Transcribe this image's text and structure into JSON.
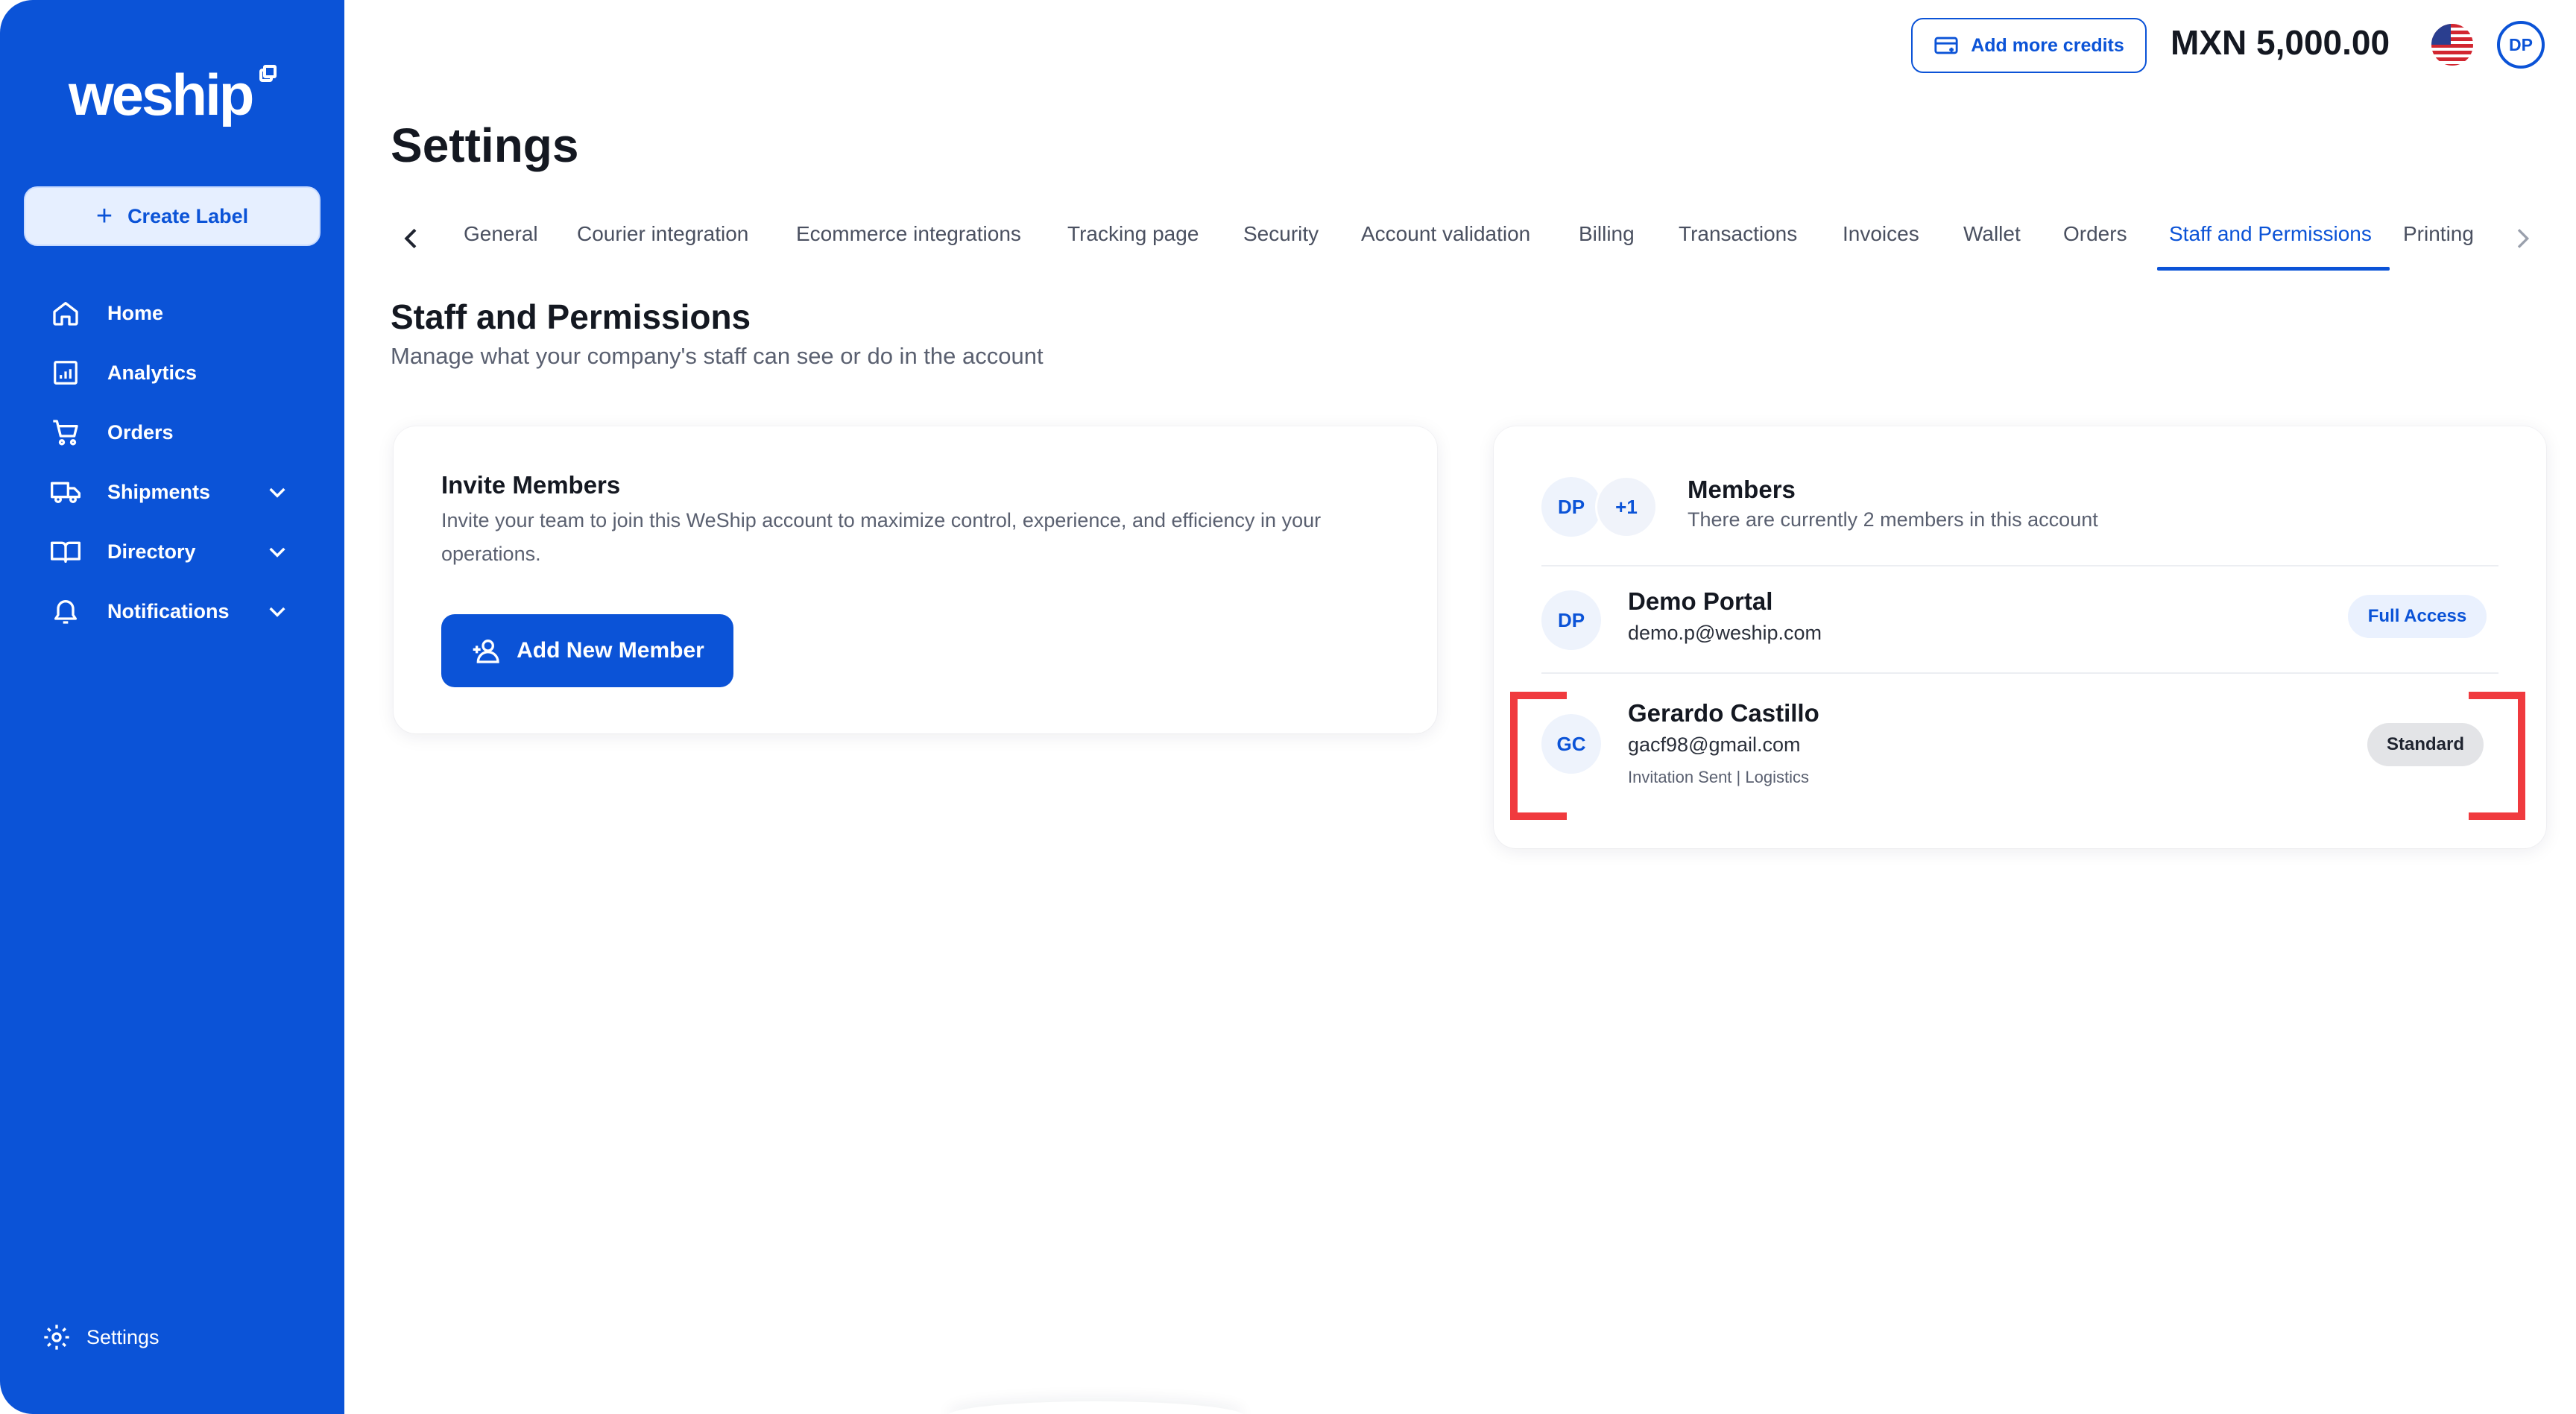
{
  "brand": {
    "logo": "weship",
    "accent": "#0b53d7",
    "highlight": "#f03a3e"
  },
  "sidebar": {
    "create_label": "Create Label",
    "items": [
      {
        "label": "Home",
        "icon": "home-icon"
      },
      {
        "label": "Analytics",
        "icon": "analytics-icon"
      },
      {
        "label": "Orders",
        "icon": "cart-icon"
      },
      {
        "label": "Shipments",
        "icon": "truck-icon",
        "expandable": true
      },
      {
        "label": "Directory",
        "icon": "book-icon",
        "expandable": true
      },
      {
        "label": "Notifications",
        "icon": "bell-icon",
        "expandable": true
      }
    ],
    "settings_label": "Settings"
  },
  "header": {
    "credits_button": "Add more credits",
    "balance": "MXN 5,000.00",
    "flag": "us-flag-icon",
    "user_initials": "DP"
  },
  "page": {
    "title": "Settings",
    "tabs": [
      "General",
      "Courier integration",
      "Ecommerce integrations",
      "Tracking page",
      "Security",
      "Account validation",
      "Billing",
      "Transactions",
      "Invoices",
      "Wallet",
      "Orders",
      "Staff and Permissions",
      "Printing"
    ],
    "active_tab": "Staff and Permissions",
    "section_title": "Staff and Permissions",
    "section_subtitle": "Manage what your company's staff can see or do in the account"
  },
  "invite": {
    "title": "Invite Members",
    "description": "Invite your team to join this WeShip account to maximize control, experience, and efficiency in your operations.",
    "button": "Add New Member"
  },
  "members": {
    "title": "Members",
    "subtitle": "There are currently 2 members in this account",
    "avatar_initials": "DP",
    "extra_count": "+1",
    "list": [
      {
        "initials": "DP",
        "name": "Demo Portal",
        "email": "demo.p@weship.com",
        "meta": "",
        "role": "Full Access"
      },
      {
        "initials": "GC",
        "name": "Gerardo Castillo",
        "email": "gacf98@gmail.com",
        "meta": "Invitation Sent | Logistics",
        "role": "Standard"
      }
    ]
  }
}
